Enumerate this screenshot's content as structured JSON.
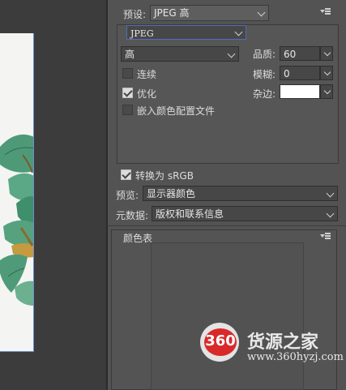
{
  "preset": {
    "label": "预设:",
    "value": "JPEG 高"
  },
  "format": {
    "value": "JPEG"
  },
  "quality_level": {
    "value": "高"
  },
  "options": {
    "progressive": {
      "label": "连续",
      "checked": false
    },
    "optimized": {
      "label": "优化",
      "checked": true
    },
    "embed_profile": {
      "label": "嵌入颜色配置文件",
      "checked": false
    }
  },
  "quality": {
    "label": "品质:",
    "value": "60"
  },
  "blur": {
    "label": "模糊:",
    "value": "0"
  },
  "matte": {
    "label": "杂边:",
    "color": "#ffffff"
  },
  "convert_srgb": {
    "label": "转换为 sRGB",
    "checked": true
  },
  "preview": {
    "label": "预览:",
    "value": "显示器颜色"
  },
  "metadata": {
    "label": "元数据:",
    "value": "版权和联系信息"
  },
  "color_table": {
    "title": "颜色表"
  },
  "watermark": {
    "logo_text": "360",
    "title": "货源之家",
    "url": "www.360hyzj.com"
  }
}
